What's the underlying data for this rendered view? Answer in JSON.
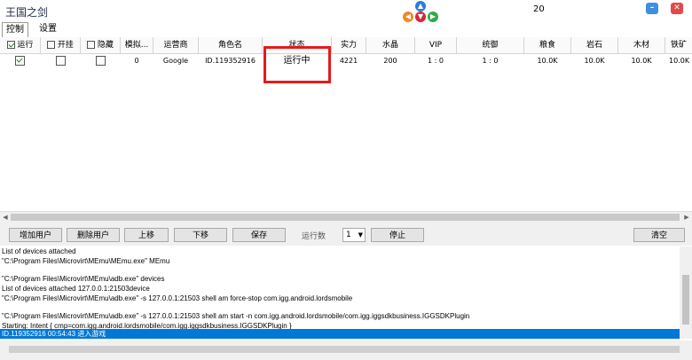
{
  "window": {
    "title": "王国之剑",
    "counter": "20",
    "nav_arrows": [
      "up-arrow-icon",
      "left-arrow-icon",
      "down-arrow-icon",
      "right-arrow-icon"
    ],
    "colors": {
      "up": "#2a7fd6",
      "left": "#f08a1c",
      "down": "#d7263d",
      "right": "#2eaa4a",
      "minimize": "#3f8fe0",
      "close": "#e04a4a",
      "highlight": "#e51b1b",
      "selection": "#0078d7"
    }
  },
  "tabs": [
    {
      "label": "控制",
      "active": true
    },
    {
      "label": "设置",
      "active": false
    }
  ],
  "grid": {
    "columns": [
      "运行",
      "开挂",
      "隐藏",
      "模拟...",
      "运营商",
      "角色名",
      "状态",
      "实力",
      "水晶",
      "VIP",
      "统御",
      "粮食",
      "岩石",
      "木材",
      "铁矿"
    ],
    "header_checks": {
      "run": true,
      "cheat": false,
      "hide": false
    },
    "rows": [
      {
        "run": true,
        "cheat": false,
        "hide": false,
        "sim": "0",
        "operator": "Google",
        "role": "ID.119352916",
        "status": "运行中",
        "power": "4221",
        "crystal": "200",
        "vip": "1 : 0",
        "command": "1 : 0",
        "food": "10.0K",
        "stone": "10.0K",
        "wood": "10.0K",
        "ore": "10.0K"
      }
    ]
  },
  "toolbar": {
    "add_user": "增加用户",
    "delete_user": "删除用户",
    "move_up": "上移",
    "move_down": "下移",
    "save": "保存",
    "run_count_label": "运行数",
    "run_count_value": "1",
    "stop": "停止",
    "clear": "清空"
  },
  "log": {
    "lines": [
      "List of devices attached",
      "\"C:\\Program Files\\Microvirt\\MEmu\\MEmu.exe\" MEmu",
      "",
      "\"C:\\Program Files\\Microvirt\\MEmu\\adb.exe\" devices",
      "List of devices attached 127.0.0.1:21503device",
      "\"C:\\Program Files\\Microvirt\\MEmu\\adb.exe\" -s 127.0.0.1:21503 shell am force-stop com.igg.android.lordsmobile",
      "",
      "\"C:\\Program Files\\Microvirt\\MEmu\\adb.exe\" -s 127.0.0.1:21503 shell am start -n com.igg.android.lordsmobile/com.igg.iggsdkbusiness.IGGSDKPlugin",
      "Starting: Intent { cmp=com.igg.android.lordsmobile/com.igg.iggsdkbusiness.IGGSDKPlugin }"
    ],
    "selected_line": "ID.119352916   00:54:43   进入游戏"
  }
}
